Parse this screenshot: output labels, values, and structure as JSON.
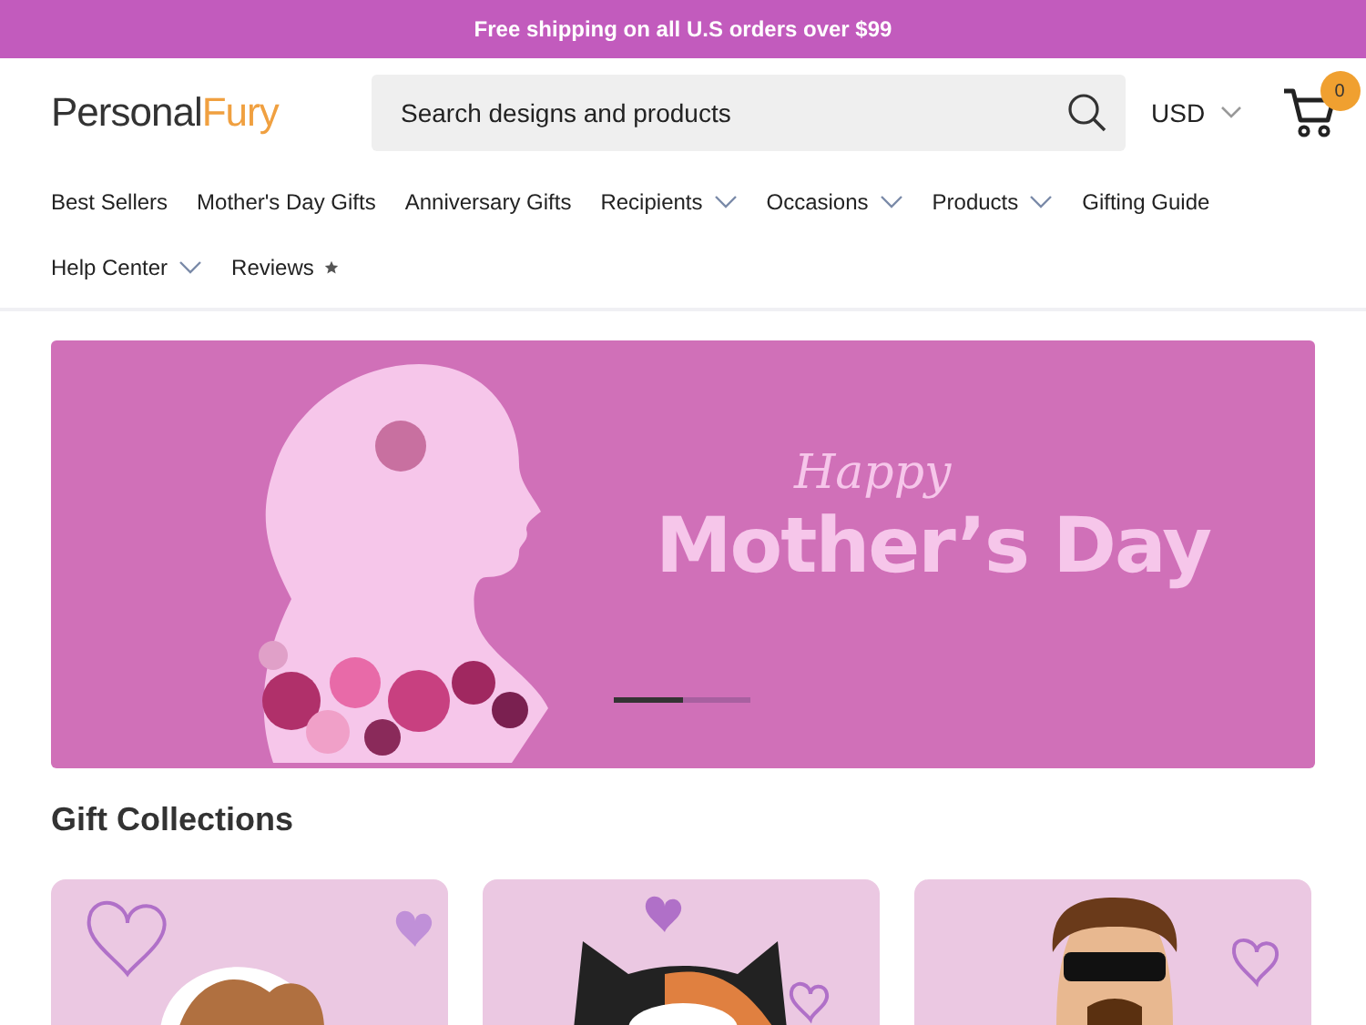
{
  "promo_bar": {
    "text": "Free shipping on all U.S orders over $99"
  },
  "header": {
    "logo": {
      "first": "Personal",
      "second": "Fury"
    },
    "search": {
      "placeholder": "Search designs and products"
    },
    "currency": "USD",
    "cart_count": "0"
  },
  "nav": [
    {
      "label": "Best Sellers",
      "kind": "link"
    },
    {
      "label": "Mother's Day Gifts",
      "kind": "link"
    },
    {
      "label": "Anniversary Gifts",
      "kind": "link"
    },
    {
      "label": "Recipients",
      "kind": "menu"
    },
    {
      "label": "Occasions",
      "kind": "menu"
    },
    {
      "label": "Products",
      "kind": "menu"
    },
    {
      "label": "Gifting Guide",
      "kind": "link"
    },
    {
      "label": "Help Center",
      "kind": "menu"
    },
    {
      "label": "Reviews",
      "kind": "rated"
    }
  ],
  "banner": {
    "script_text": "Happy",
    "headline": "Mother’s Day",
    "slider": {
      "level": 0.5
    }
  },
  "section": {
    "title": "Gift Collections"
  },
  "collections": [
    {
      "kind": "dog"
    },
    {
      "kind": "cat"
    },
    {
      "kind": "man"
    }
  ]
}
